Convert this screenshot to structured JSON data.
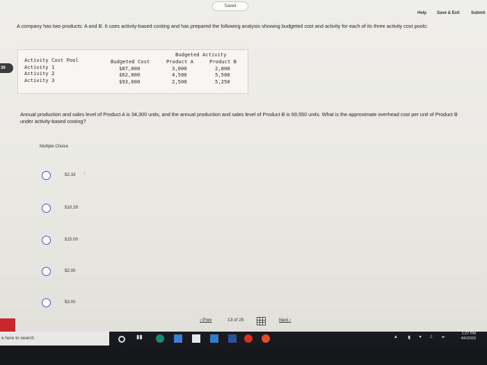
{
  "header": {
    "saved_label": "Saved",
    "help": "Help",
    "save_exit": "Save & Exit",
    "submit": "Submit"
  },
  "question": {
    "intro": "A company has two products: A and B. It uses activity-based costing and has prepared the following analysis showing budgeted cost and activity for each of its three activity cost pools:",
    "tab_number": "36",
    "text": "Annual production and sales level of Product A is 34,300 units, and the annual production and sales level of Product B is 69,550 units. What is the approximate overhead cost per unit of Product B under activity-based costing?"
  },
  "table": {
    "budgeted_activity_header": "Budgeted Activity",
    "headers": [
      "Activity Cost Pool",
      "Budgeted Cost",
      "Product A",
      "Product B"
    ],
    "rows": [
      [
        "Activity 1",
        "$87,000",
        "3,000",
        "2,800"
      ],
      [
        "Activity 2",
        "$62,000",
        "4,500",
        "5,500"
      ],
      [
        "Activity 3",
        "$93,000",
        "2,500",
        "5,250"
      ]
    ]
  },
  "choices": {
    "label": "Multiple Choice",
    "options": [
      "$2.33",
      "$10.28",
      "$15.00",
      "$2.00",
      "$3.00"
    ]
  },
  "pager": {
    "prev": "Prev",
    "current": "13",
    "of_label": "of",
    "total": "25",
    "next": "Next"
  },
  "taskbar": {
    "search_placeholder": "e here to search",
    "time": "1:27 PM",
    "date": "4/6/2020"
  },
  "colors": {
    "radio_border": "#3a5fb0",
    "taskbar": "#1a1b20",
    "red_strip": "#c9262d"
  }
}
